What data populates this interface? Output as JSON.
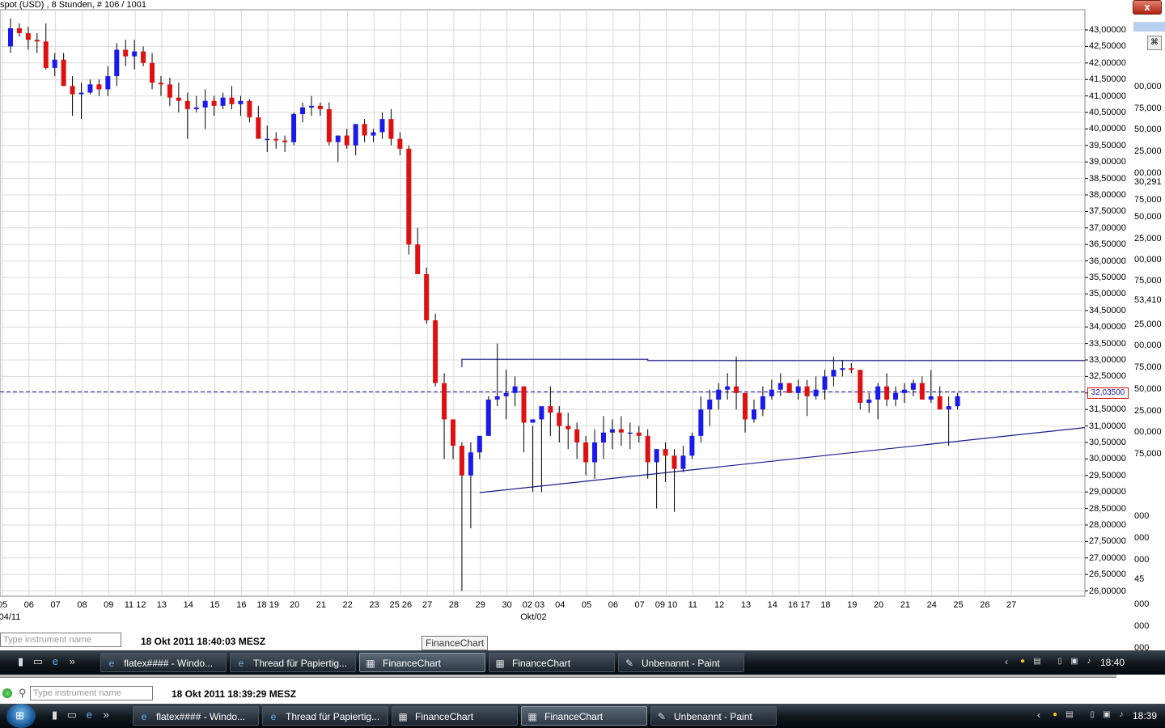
{
  "window": {
    "title": "spot (USD) , 8 Stunden, # 106 / 1001",
    "close_label": "x"
  },
  "colors": {
    "up_candle": "#1a1aee",
    "down_candle": "#e01010",
    "grid": "#d9d9d9",
    "trendline": "#1a1a8c",
    "price_line": "#1a1aa0"
  },
  "chart_data": {
    "type": "candlestick",
    "title": "spot (USD) , 8 Stunden, # 106 / 1001",
    "ylim": [
      25800,
      43500
    ],
    "y_ticks": [
      "43,00000",
      "42,50000",
      "42,00000",
      "41,50000",
      "41,00000",
      "40,50000",
      "40,00000",
      "39,50000",
      "39,00000",
      "38,50000",
      "38,00000",
      "37,50000",
      "37,00000",
      "36,50000",
      "36,00000",
      "35,50000",
      "35,00000",
      "34,50000",
      "34,00000",
      "33,50000",
      "33,00000",
      "32,50000",
      "32,00000",
      "31,50000",
      "31,00000",
      "30,50000",
      "30,00000",
      "29,50000",
      "29,00000",
      "28,50000",
      "28,00000",
      "27,50000",
      "27,00000",
      "26,50000",
      "26,00000"
    ],
    "y_tick_values": [
      43000,
      42500,
      42000,
      41500,
      41000,
      40500,
      40000,
      39500,
      39000,
      38500,
      38000,
      37500,
      37000,
      36500,
      36000,
      35500,
      35000,
      34500,
      34000,
      33500,
      33000,
      32500,
      32000,
      31500,
      31000,
      30500,
      30000,
      29500,
      29000,
      28500,
      28000,
      27500,
      27000,
      26500,
      26000
    ],
    "x_ticks": [
      {
        "idx": 0,
        "label": "05"
      },
      {
        "idx": 3,
        "label": "06"
      },
      {
        "idx": 6,
        "label": "07"
      },
      {
        "idx": 9,
        "label": "08"
      },
      {
        "idx": 12,
        "label": "09"
      },
      {
        "idx": 15,
        "label": "11 12"
      },
      {
        "idx": 18,
        "label": "13"
      },
      {
        "idx": 21,
        "label": "14"
      },
      {
        "idx": 24,
        "label": "15"
      },
      {
        "idx": 27,
        "label": "16"
      },
      {
        "idx": 30,
        "label": "18 19"
      },
      {
        "idx": 33,
        "label": "20"
      },
      {
        "idx": 36,
        "label": "21"
      },
      {
        "idx": 39,
        "label": "22"
      },
      {
        "idx": 42,
        "label": "23"
      },
      {
        "idx": 45,
        "label": "25 26"
      },
      {
        "idx": 48,
        "label": "27"
      },
      {
        "idx": 51,
        "label": "28"
      },
      {
        "idx": 54,
        "label": "29"
      },
      {
        "idx": 57,
        "label": "30"
      },
      {
        "idx": 60,
        "label": "02 03"
      },
      {
        "idx": 63,
        "label": "04"
      },
      {
        "idx": 66,
        "label": "05"
      },
      {
        "idx": 69,
        "label": "06"
      },
      {
        "idx": 72,
        "label": "07"
      },
      {
        "idx": 75,
        "label": "09 10"
      },
      {
        "idx": 78,
        "label": "11"
      },
      {
        "idx": 81,
        "label": "12"
      },
      {
        "idx": 84,
        "label": "13"
      },
      {
        "idx": 87,
        "label": "14"
      },
      {
        "idx": 90,
        "label": "16 17"
      },
      {
        "idx": 93,
        "label": "18"
      },
      {
        "idx": 96,
        "label": "19"
      },
      {
        "idx": 99,
        "label": "20"
      },
      {
        "idx": 102,
        "label": "21"
      },
      {
        "idx": 105,
        "label": "24"
      },
      {
        "idx": 108,
        "label": "25"
      },
      {
        "idx": 111,
        "label": "26"
      },
      {
        "idx": 114,
        "label": "27"
      }
    ],
    "x_sublabels": [
      {
        "idx": 0,
        "label": "04/11"
      },
      {
        "idx": 60,
        "label": "Okt/02"
      }
    ],
    "current_price": 32035,
    "current_price_label": "32,03500",
    "trendlines": [
      {
        "name": "resistance",
        "points": [
          [
            51,
            32780
          ],
          [
            51,
            33020
          ],
          [
            72,
            33020
          ],
          [
            72,
            32980
          ],
          [
            129,
            32980
          ]
        ]
      },
      {
        "name": "support",
        "points": [
          [
            53,
            28980
          ],
          [
            129,
            30950
          ]
        ]
      }
    ],
    "candles": [
      [
        42500,
        43350,
        42300,
        43050
      ],
      [
        43050,
        43200,
        42800,
        42900
      ],
      [
        42900,
        43100,
        42400,
        42700
      ],
      [
        42700,
        42900,
        42300,
        42650
      ],
      [
        42650,
        43200,
        41800,
        41850
      ],
      [
        41850,
        42300,
        41600,
        42100
      ],
      [
        42100,
        42300,
        41300,
        41300
      ],
      [
        41300,
        41600,
        40400,
        41050
      ],
      [
        41050,
        41400,
        40300,
        41100
      ],
      [
        41100,
        41500,
        41050,
        41350
      ],
      [
        41350,
        41500,
        41000,
        41200
      ],
      [
        41200,
        41900,
        41000,
        41600
      ],
      [
        41600,
        42600,
        41300,
        42400
      ],
      [
        42400,
        42700,
        41900,
        42200
      ],
      [
        42200,
        42700,
        41800,
        42350
      ],
      [
        42350,
        42500,
        41900,
        42000
      ],
      [
        42000,
        42300,
        41200,
        41400
      ],
      [
        41400,
        41600,
        41000,
        41350
      ],
      [
        41350,
        41550,
        40700,
        40950
      ],
      [
        40950,
        41400,
        40500,
        40850
      ],
      [
        40850,
        41100,
        39700,
        40600
      ],
      [
        40600,
        41000,
        40500,
        40650
      ],
      [
        40650,
        41200,
        40000,
        40850
      ],
      [
        40850,
        41000,
        40400,
        40700
      ],
      [
        40700,
        41100,
        40600,
        40950
      ],
      [
        40950,
        41300,
        40600,
        40750
      ],
      [
        40750,
        41000,
        40400,
        40850
      ],
      [
        40850,
        40900,
        40200,
        40350
      ],
      [
        40350,
        40700,
        39800,
        39700
      ],
      [
        39700,
        40100,
        39300,
        39700
      ],
      [
        39700,
        39900,
        39400,
        39650
      ],
      [
        39650,
        39800,
        39300,
        39600
      ],
      [
        39600,
        40500,
        39500,
        40450
      ],
      [
        40450,
        40800,
        40200,
        40650
      ],
      [
        40650,
        41000,
        40400,
        40700
      ],
      [
        40700,
        40800,
        40400,
        40600
      ],
      [
        40600,
        40800,
        39500,
        39600
      ],
      [
        39600,
        39800,
        39000,
        39800
      ],
      [
        39800,
        40000,
        39400,
        39500
      ],
      [
        39500,
        40100,
        39200,
        40150
      ],
      [
        40150,
        40300,
        39600,
        39800
      ],
      [
        39800,
        40000,
        39600,
        39900
      ],
      [
        39900,
        40500,
        39700,
        40300
      ],
      [
        40300,
        40600,
        39500,
        39700
      ],
      [
        39700,
        39900,
        39200,
        39400
      ],
      [
        39400,
        39500,
        36200,
        36500
      ],
      [
        36500,
        37000,
        35900,
        35600
      ],
      [
        35600,
        35800,
        34100,
        34200
      ],
      [
        34200,
        34400,
        32200,
        32300
      ],
      [
        32300,
        32600,
        30000,
        31200
      ],
      [
        31200,
        31200,
        30000,
        30400
      ],
      [
        30400,
        30500,
        26000,
        29500
      ],
      [
        29500,
        30500,
        27900,
        30200
      ],
      [
        30200,
        30500,
        30000,
        30700
      ],
      [
        30700,
        31900,
        30700,
        31800
      ],
      [
        31800,
        33500,
        31600,
        31900
      ],
      [
        31900,
        32700,
        31200,
        32000
      ],
      [
        32000,
        32500,
        31600,
        32200
      ],
      [
        32200,
        32200,
        30200,
        31100
      ],
      [
        31100,
        31000,
        29000,
        31200
      ],
      [
        31200,
        31500,
        29000,
        31600
      ],
      [
        31600,
        32200,
        30700,
        31400
      ],
      [
        31400,
        31600,
        30500,
        31000
      ],
      [
        31000,
        31400,
        30300,
        30900
      ],
      [
        30900,
        31100,
        30000,
        30500
      ],
      [
        30500,
        30700,
        29500,
        29900
      ],
      [
        29900,
        30900,
        29400,
        30500
      ],
      [
        30500,
        31300,
        30000,
        30800
      ],
      [
        30800,
        31200,
        30300,
        30900
      ],
      [
        30900,
        31300,
        30400,
        30800
      ],
      [
        30800,
        31100,
        30300,
        30800
      ],
      [
        30800,
        31000,
        30500,
        30700
      ],
      [
        30700,
        30900,
        29400,
        29900
      ],
      [
        29900,
        30300,
        28500,
        30300
      ],
      [
        30300,
        30500,
        29300,
        30100
      ],
      [
        30100,
        30300,
        28400,
        29700
      ],
      [
        29700,
        30400,
        29600,
        30100
      ],
      [
        30100,
        30800,
        30000,
        30700
      ],
      [
        30700,
        31900,
        30500,
        31500
      ],
      [
        31500,
        32100,
        31000,
        31800
      ],
      [
        31800,
        32300,
        31500,
        32100
      ],
      [
        32100,
        32600,
        31800,
        32200
      ],
      [
        32200,
        33100,
        31500,
        32000
      ],
      [
        32000,
        32000,
        30800,
        31200
      ],
      [
        31200,
        31800,
        31100,
        31500
      ],
      [
        31500,
        32200,
        31300,
        31900
      ],
      [
        31900,
        32400,
        31800,
        32100
      ],
      [
        32100,
        32600,
        31900,
        32300
      ],
      [
        32300,
        32300,
        32000,
        32000
      ],
      [
        32000,
        32400,
        31800,
        32200
      ],
      [
        32200,
        32400,
        31300,
        31900
      ],
      [
        31900,
        32500,
        31800,
        32100
      ],
      [
        32100,
        32700,
        31800,
        32500
      ],
      [
        32500,
        33100,
        32200,
        32700
      ],
      [
        32700,
        33000,
        32500,
        32750
      ],
      [
        32750,
        32900,
        32600,
        32700
      ],
      [
        32700,
        32700,
        31500,
        31700
      ],
      [
        31700,
        32000,
        31400,
        31800
      ],
      [
        31800,
        32300,
        31200,
        32200
      ],
      [
        32200,
        32600,
        31600,
        31800
      ],
      [
        31800,
        32200,
        31600,
        32000
      ],
      [
        32000,
        32300,
        31700,
        32100
      ],
      [
        32100,
        32400,
        31900,
        32300
      ],
      [
        32300,
        32500,
        31900,
        31800
      ],
      [
        31800,
        32700,
        31700,
        31900
      ],
      [
        31900,
        32200,
        31500,
        31500
      ],
      [
        31500,
        31900,
        30400,
        31600
      ],
      [
        31600,
        32000,
        31500,
        31900
      ]
    ]
  },
  "right_panel": {
    "partial_labels": [
      "00,000",
      "75,000",
      "50,000",
      "25,000",
      "00,000",
      "30,291",
      "75,000",
      "50,000",
      "25,000",
      "00,000",
      "75,000",
      "53,410",
      "25,000",
      "00,000",
      "75,000",
      "50,000",
      "25,000",
      "00,000",
      "75,000",
      "45",
      "000",
      "000",
      "000",
      "000",
      "000",
      "000"
    ]
  },
  "tooltip": {
    "text": "FinanceChart"
  },
  "instrument_bar_upper": {
    "placeholder": "Type instrument name",
    "datetime": "18 Okt 2011 18:40:03 MESZ"
  },
  "instrument_bar_lower": {
    "placeholder": "Type instrument name",
    "datetime": "18 Okt 2011 18:39:29 MESZ"
  },
  "taskbar_upper": {
    "items": [
      "flatex#### - Windo...",
      "Thread für Papiertig...",
      "FinanceChart",
      "FinanceChart",
      "Unbenannt - Paint"
    ],
    "active_index": 2,
    "clock": "18:40"
  },
  "taskbar_lower": {
    "items": [
      "flatex#### - Windo...",
      "Thread für Papiertig...",
      "FinanceChart",
      "FinanceChart",
      "Unbenannt - Paint"
    ],
    "active_index": 3,
    "clock": "18:39"
  }
}
